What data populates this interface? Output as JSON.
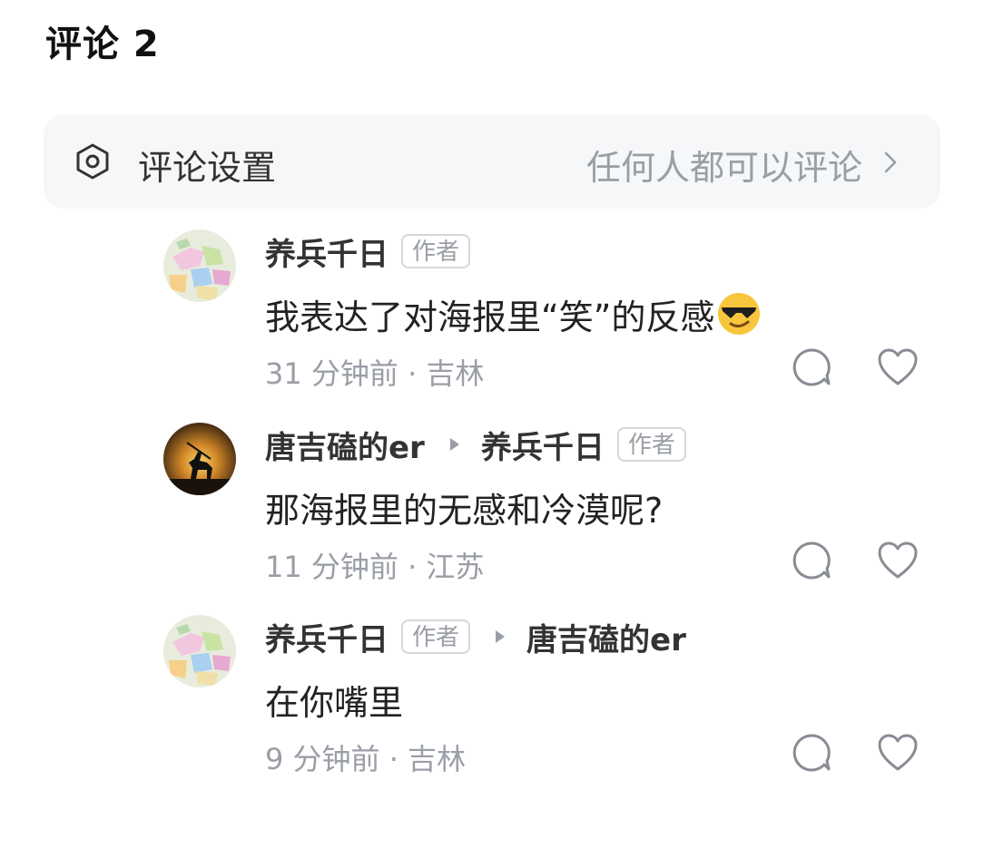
{
  "header": {
    "title": "评论 2"
  },
  "settings": {
    "icon": "settings-hexagon-icon",
    "label": "评论设置",
    "value": "任何人都可以评论",
    "chevron": "chevron-right-icon"
  },
  "comments": [
    {
      "username": "养兵千日",
      "author_badge": "作者",
      "text": "我表达了对海报里“笑”的反感",
      "emoji": "smiling-face-with-sunglasses",
      "meta": "31 分钟前 · 吉林"
    },
    {
      "username": "唐吉磕的er",
      "reply_to": "养兵千日",
      "reply_to_badge": "作者",
      "text": "那海报里的无感和冷漠呢?",
      "meta": "11 分钟前 · 江苏"
    },
    {
      "username": "养兵千日",
      "author_badge": "作者",
      "reply_to": "唐吉磕的er",
      "text": "在你嘴里",
      "meta": "9 分钟前 · 吉林"
    }
  ],
  "colors": {
    "settings_bg": "#f6f7f9",
    "muted_text": "#9a9ea6",
    "primary_text": "#222222"
  }
}
